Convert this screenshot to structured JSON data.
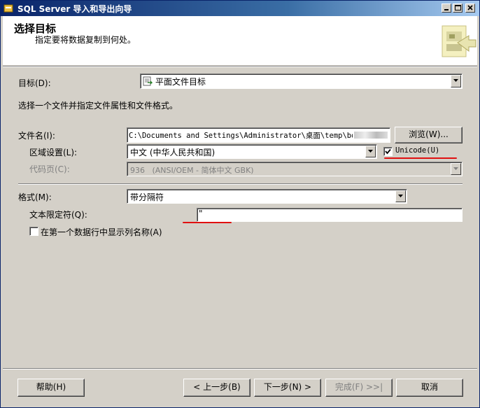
{
  "window": {
    "title": "SQL Server 导入和导出向导"
  },
  "header": {
    "title": "选择目标",
    "subtitle": "指定要将数据复制到何处。"
  },
  "destination": {
    "label": "目标(D):",
    "value": "平面文件目标"
  },
  "instruction": "选择一个文件并指定文件属性和文件格式。",
  "file": {
    "label": "文件名(I):",
    "value": "C:\\Documents and Settings\\Administrator\\桌面\\temp\\bdc\\",
    "browse_label": "浏览(W)..."
  },
  "locale": {
    "label": "区域设置(L):",
    "value": "中文 (中华人民共和国)"
  },
  "unicode": {
    "label": "Unicode(U)",
    "checked": true
  },
  "codepage": {
    "label": "代码页(C):",
    "value": "936   (ANSI/OEM - 简体中文 GBK)"
  },
  "format": {
    "label": "格式(M):",
    "value": "带分隔符"
  },
  "text_qualifier": {
    "label": "文本限定符(Q):",
    "value": "\""
  },
  "column_names": {
    "label": "在第一个数据行中显示列名称(A)",
    "checked": false
  },
  "buttons": {
    "help": "帮助(H)",
    "back": "< 上一步(B)",
    "next": "下一步(N) >",
    "finish": "完成(F) >>|",
    "cancel": "取消"
  },
  "colors": {
    "titlebar": "#0a246a",
    "face": "#d4d0c8",
    "annotation": "#e01010"
  }
}
